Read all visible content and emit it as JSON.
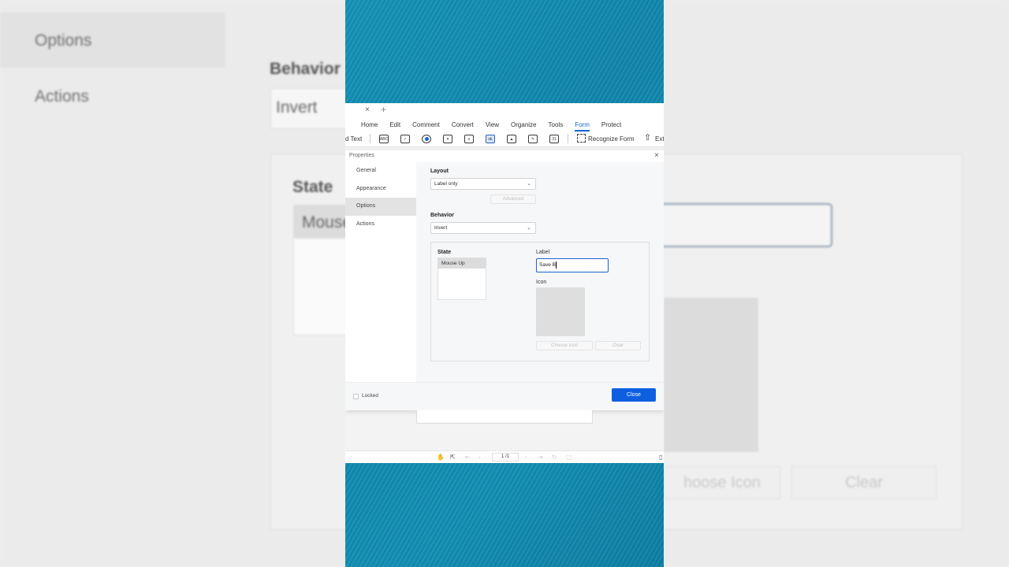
{
  "background": {
    "sidebar": {
      "options": "Options",
      "actions": "Actions"
    },
    "behavior_heading": "Behavior",
    "behavior_value": "Invert",
    "state_heading": "State",
    "state_item": "Mouse",
    "choose_icon": "hoose Icon",
    "clear": "Clear"
  },
  "app": {
    "tabbar": {
      "close": "×",
      "new_tab": "+"
    },
    "menu": [
      "Home",
      "Edit",
      "Comment",
      "Convert",
      "View",
      "Organize",
      "Tools",
      "Form",
      "Protect"
    ],
    "active_menu": "Form",
    "toolbar": {
      "add_text_label": "d Text",
      "tool_icons": [
        "text-field-icon",
        "checkbox-icon",
        "radio-button-icon",
        "combo-box-icon",
        "list-box-icon",
        "button-icon",
        "image-field-icon",
        "signature-field-icon",
        "date-field-icon"
      ],
      "button_tool_glyph": "ok",
      "text_tool_glyph": "ABC",
      "date_tool_glyph": "31",
      "recognize_form": "Recognize Form",
      "extract": "Ext"
    }
  },
  "dialog": {
    "title": "Properties",
    "close_glyph": "×",
    "nav": [
      "General",
      "Appearance",
      "Options",
      "Actions"
    ],
    "active_nav": "Options",
    "layout": {
      "label": "Layout",
      "value": "Label only",
      "advanced_button": "Advanced"
    },
    "behavior": {
      "label": "Behavior",
      "value": "Invert"
    },
    "state": {
      "label": "State",
      "items": [
        "Mouse Up"
      ]
    },
    "label_field": {
      "label": "Label",
      "value": "Save B"
    },
    "icon": {
      "label": "Icon",
      "choose_button": "Choose Icon",
      "clear_button": "Clear"
    },
    "footer": {
      "locked_label": "Locked",
      "locked_checked": false,
      "close_button": "Close"
    }
  },
  "statusbar": {
    "page_indicator": "1 /1"
  },
  "colors": {
    "accent": "#0e5fe0",
    "strip": "#1290b4",
    "nav_active": "#e3e3e3"
  }
}
